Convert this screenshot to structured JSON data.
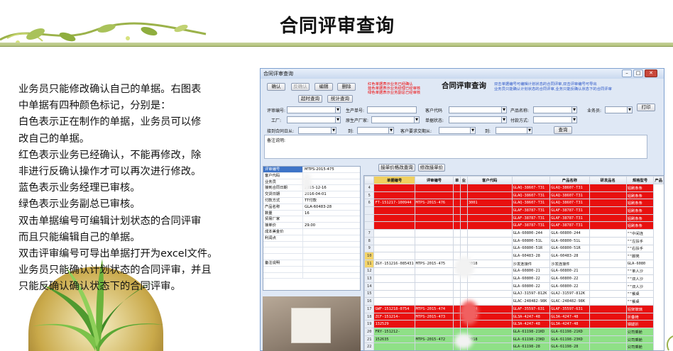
{
  "slide": {
    "title": "合同评审查询",
    "description_lines": [
      "业务员只能修改确认自己的单据。右图表",
      "中单据有四种颜色标记，分别是：",
      "白色表示正在制作的单据，业务员可以修",
      "改自己的单据。",
      "红色表示业务已经确认，不能再修改，除",
      "非进行反确认操作才可以再次进行修改。",
      "蓝色表示业务经理已审核。",
      "绿色表示业务副总已审核。",
      "双击单据编号可编辑计划状态的合同评审",
      "而且只能编辑自己的单据。",
      "双击评审编号可导出单据打开为excel文件。",
      "业务员只能确认计划状态的合同评审，并且",
      "只能反确认确认状态下的合同评审。"
    ]
  },
  "window": {
    "title": "合同评审查询",
    "controls": {
      "minimize": "–",
      "maximize": "□",
      "close": "✕"
    },
    "heading": "合同评审查询",
    "toolbar": {
      "confirm": "确认",
      "unconfirm": "反确认",
      "edit": "编辑",
      "delete": "删除",
      "overdue_query": "超时查询",
      "stats_query": "统计查询",
      "print": "打印",
      "query": "查询",
      "grid_edit_price": "接单价格改查询",
      "grid_edit_order": "修改接单价"
    },
    "legend": {
      "red": "红色单据表示业务已经确认",
      "blue": "蓝色单据表示业务经理已经审核",
      "green": "绿色单据表示业务副总已经审核"
    },
    "notice": [
      "双击单据编号可编辑计划状态的合同评审,双击评审编号可导出",
      "业务员只能确认计划状态的合同评审,业务只能反确认状态下的合同评审"
    ],
    "filters": {
      "review_no": "评审编号:",
      "producer_no": "生产单号:",
      "customer_code": "客户代码",
      "product_name": "产品名称:",
      "salesman": "业务员:",
      "factory": "工厂:",
      "origin_factory": "原生产厂家:",
      "doc_status": "单据状态:",
      "payment": "付款方式:",
      "order_date_from": "接到合同日从:",
      "to1": "到:",
      "cust_delivery": "客户要求交期从:",
      "to2": "到:",
      "remark": "备注说明:"
    },
    "detail_panel": {
      "rows": [
        {
          "k": "评审编号",
          "v": "MTPS-2015-475",
          "sel": true
        },
        {
          "k": "客户代码",
          "v": ""
        },
        {
          "k": "业务员",
          "v": ""
        },
        {
          "k": "接到合同日期",
          "v": "2015-12-16"
        },
        {
          "k": "交货日期",
          "v": "2016-04-01"
        },
        {
          "k": "付款方式",
          "v": "TT付款"
        },
        {
          "k": "产品名称",
          "v": "GLA-60483-28"
        },
        {
          "k": "数量",
          "v": "16"
        },
        {
          "k": "贸易厂家",
          "v": ""
        },
        {
          "k": "接单价",
          "v": "29.00"
        },
        {
          "k": "成本美金价",
          "v": ""
        },
        {
          "k": "利润点",
          "v": ""
        },
        {
          "k": "",
          "v": ""
        },
        {
          "k": "",
          "v": ""
        },
        {
          "k": "",
          "v": ""
        },
        {
          "k": "备注说明",
          "v": ""
        },
        {
          "k": "",
          "v": ""
        },
        {
          "k": "",
          "v": ""
        }
      ]
    },
    "grid": {
      "columns": [
        "单据编号",
        "评审编号",
        "单",
        "业",
        "客户代码",
        "产品名称",
        "研发品名",
        "规格型号",
        "产品"
      ],
      "rows": [
        {
          "n": "4",
          "c": "r",
          "doc": "",
          "rev": "",
          "cust": "",
          "p": "GLAQ-38607-T31",
          "d": "GLAQ-38607-T31",
          "x": "铝刷条条"
        },
        {
          "n": "5",
          "c": "r",
          "doc": "",
          "rev": "",
          "cust": "",
          "p": "GLAQ-38607-T31",
          "d": "GLAQ-38607-T31",
          "x": "铝刷条条"
        },
        {
          "n": "6",
          "c": "r",
          "doc": "FT-151217-100944",
          "rev": "MTPS-2015-476",
          "cust": "3001",
          "p": "GLAQ-38607-T31",
          "d": "GLAQ-38607-T31",
          "x": "铝刷条条"
        },
        {
          "n": "",
          "c": "r",
          "doc": "",
          "rev": "",
          "cust": "",
          "p": "GLAF-38787-T31",
          "d": "GLAF-38787-T31",
          "x": "铝刷条条"
        },
        {
          "n": "",
          "c": "r",
          "doc": "",
          "rev": "",
          "cust": "",
          "p": "GLAF-38787-T31",
          "d": "GLAF-38787-T31",
          "x": "铝刷条条"
        },
        {
          "n": "",
          "c": "r",
          "doc": "",
          "rev": "",
          "cust": "",
          "p": "GLAF-38787-T31",
          "d": "GLAF-38787-T31",
          "x": "铝刷条条"
        },
        {
          "n": "7",
          "c": "w",
          "doc": "",
          "rev": "",
          "cust": "",
          "p": "GLA-60800-244",
          "d": "GLA-60800-244",
          "x": "\"\"中间连"
        },
        {
          "n": "8",
          "c": "w",
          "doc": "",
          "rev": "",
          "cust": "",
          "p": "GLA-60800-51L",
          "d": "GLA-60800-51L",
          "x": "\"\"左扶手"
        },
        {
          "n": "9",
          "c": "w",
          "doc": "",
          "rev": "",
          "cust": "",
          "p": "GLA-60800-51R",
          "d": "GLA-60800-51R",
          "x": "\"\"右扶手"
        },
        {
          "n": "10",
          "c": "w",
          "doc": "",
          "rev": "",
          "cust": "",
          "p": "GLA-60483-28",
          "d": "GLA-60483-28",
          "x": "\"\"脚凳"
        },
        {
          "n": "11",
          "c": "w",
          "doc": "ZGY-151216-085431",
          "rev": "MTPS-2015-475",
          "cust": "3018",
          "p": "沙发连接件",
          "d": "沙发连接件",
          "x": "GLA-6080"
        },
        {
          "n": "12",
          "c": "w",
          "doc": "",
          "rev": "",
          "cust": "",
          "p": "GLA-60800-21",
          "d": "GLA-60800-21",
          "x": "\"\"单人沙"
        },
        {
          "n": "13",
          "c": "w",
          "doc": "",
          "rev": "",
          "cust": "",
          "p": "GLA-60800-22",
          "d": "GLA-60800-22",
          "x": "\"\"双人沙"
        },
        {
          "n": "14",
          "c": "w",
          "doc": "",
          "rev": "",
          "cust": "",
          "p": "GLA-60800-22",
          "d": "GLA-60800-22",
          "x": "\"\"双人沙"
        },
        {
          "n": "15",
          "c": "w",
          "doc": "",
          "rev": "",
          "cust": "",
          "p": "GLAJ-31597-812K",
          "d": "GLAJ-31597-812K",
          "x": "\"\"餐桌"
        },
        {
          "n": "16",
          "c": "w",
          "doc": "",
          "rev": "",
          "cust": "",
          "p": "GLAC-248482-98K",
          "d": "GLAC-248482-98K",
          "x": "\"\"餐桌"
        },
        {
          "n": "17",
          "c": "r",
          "doc": "GWF-151218-0754",
          "rev": "MTPS-2015-474",
          "cust": "5024",
          "p": "GLAF-35597-631",
          "d": "GLAF-35597-631",
          "x": "铝架玻璃"
        },
        {
          "n": "18",
          "c": "r",
          "doc": "ZCF-151214-",
          "rev": "MTPS-2015-473",
          "cust": "3017",
          "p": "GL3A-4247-48",
          "d": "GL3A-4247-48",
          "x": "折叠椅"
        },
        {
          "n": "19",
          "c": "r",
          "doc": "132529",
          "rev": "",
          "cust": "",
          "p": "GL3A-4247-48",
          "d": "GL3A-4247-48",
          "x": "钢腿折"
        },
        {
          "n": "20",
          "c": "g",
          "doc": "FRY-151212-",
          "rev": "",
          "cust": "",
          "p": "GLA-61198-21KD",
          "d": "GLA-61198-21KD",
          "x": "公司乘舱"
        },
        {
          "n": "21",
          "c": "g",
          "doc": "152635",
          "rev": "MTPS-2015-472",
          "cust": "2018",
          "p": "GLA-61198-23KD",
          "d": "GLA-61198-23KD",
          "x": "公司乘舱"
        },
        {
          "n": "22",
          "c": "g",
          "doc": "",
          "rev": "",
          "cust": "",
          "p": "GLA-61198-28",
          "d": "GLA-61198-28",
          "x": "公司乘舱"
        }
      ]
    }
  }
}
